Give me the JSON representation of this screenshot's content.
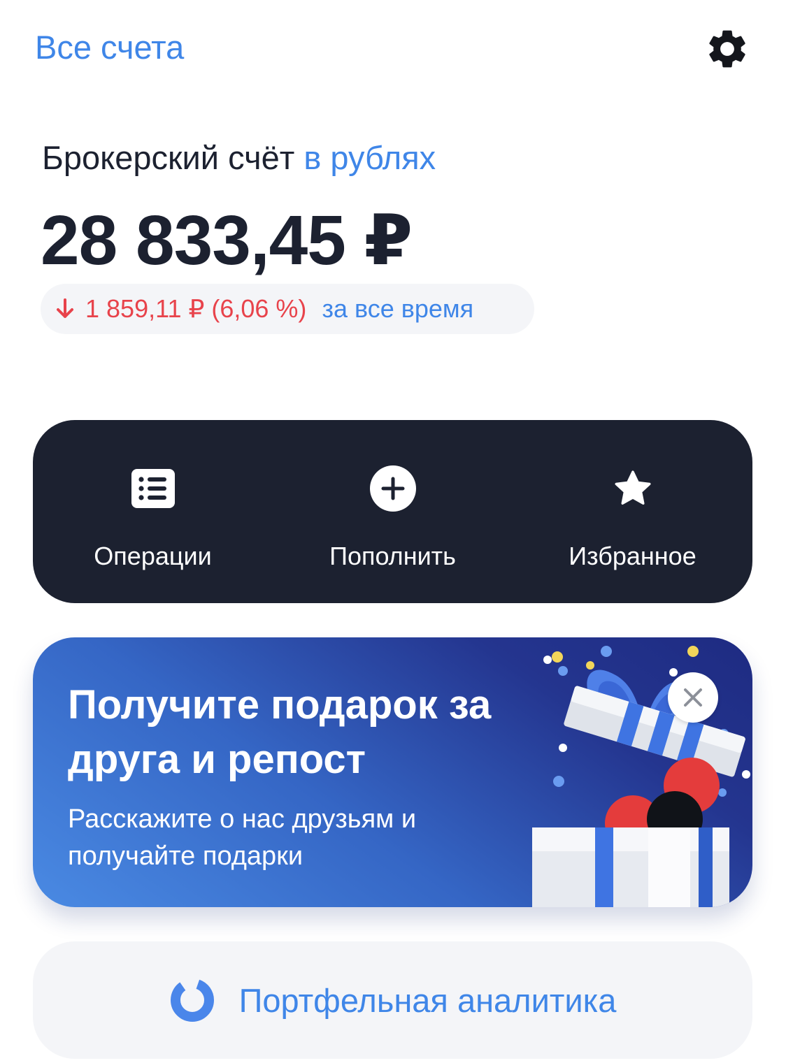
{
  "header": {
    "all_accounts_label": "Все счета",
    "settings_icon": "gear-icon"
  },
  "account": {
    "title": "Брокерский счёт",
    "currency_label": "в рублях",
    "balance": "28 833,45 ₽"
  },
  "yield": {
    "direction": "down",
    "value": "1 859,11 ₽ (6,06 %)",
    "period": "за все время",
    "color": "#e8434b"
  },
  "actions": [
    {
      "label": "Операции",
      "icon": "list-icon"
    },
    {
      "label": "Пополнить",
      "icon": "plus-circle-icon"
    },
    {
      "label": "Избранное",
      "icon": "star-icon"
    }
  ],
  "promo": {
    "title": "Получите подарок за друга и репост",
    "text": "Расскажите о нас друзьям и получайте подарки",
    "close_icon": "close-icon",
    "illustration": "gift-box-illustration"
  },
  "analytics": {
    "label": "Портфельная аналитика",
    "icon": "ring-chart-icon"
  },
  "colors": {
    "accent": "#3f86e8",
    "dark": "#1c2130",
    "negative": "#e8434b",
    "pill_bg": "#f4f5f8"
  }
}
